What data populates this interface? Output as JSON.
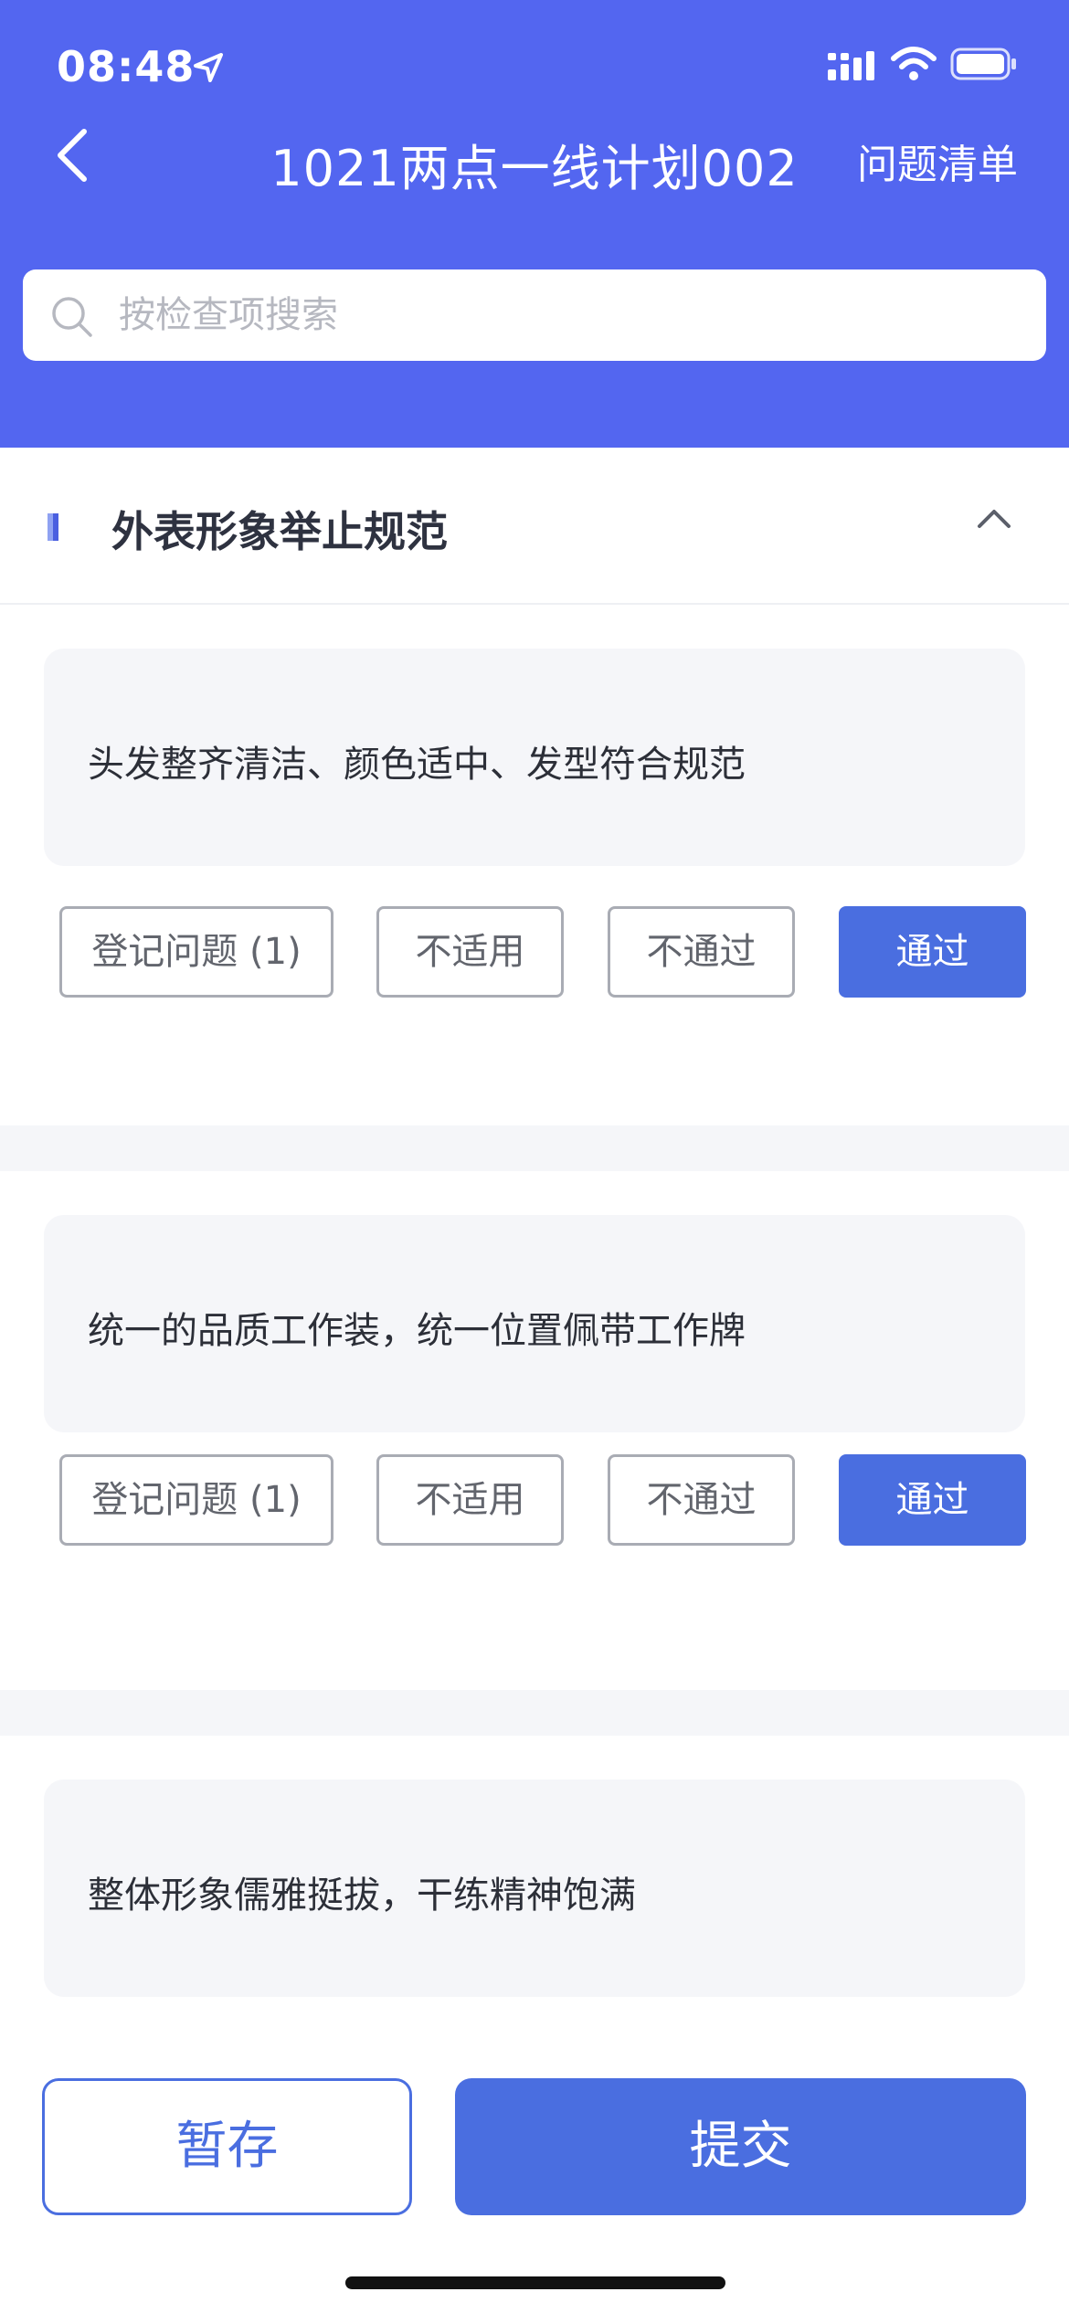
{
  "status_bar": {
    "time": "08:48"
  },
  "nav": {
    "title": "1021两点一线计划002",
    "right_action": "问题清单"
  },
  "search": {
    "placeholder": "按检查项搜索"
  },
  "section": {
    "title": "外表形象举止规范"
  },
  "items": [
    {
      "text": "头发整齐清洁、颜色适中、发型符合规范",
      "register_label": "登记问题 (1)",
      "na_label": "不适用",
      "fail_label": "不通过",
      "pass_label": "通过",
      "selected": "通过"
    },
    {
      "text": "统一的品质工作装，统一位置佩带工作牌",
      "register_label": "登记问题 (1)",
      "na_label": "不适用",
      "fail_label": "不通过",
      "pass_label": "通过",
      "selected": "通过"
    },
    {
      "text": "整体形象儒雅挺拔，干练精神饱满"
    }
  ],
  "bottom": {
    "save_label": "暂存",
    "submit_label": "提交"
  },
  "colors": {
    "header": "#5366f0",
    "accent": "#4a6ee0",
    "card_bg": "#f5f6f9"
  }
}
